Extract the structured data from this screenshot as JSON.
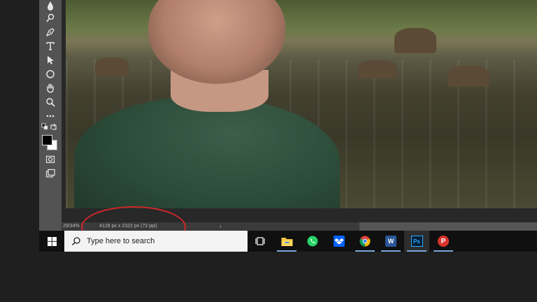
{
  "status_bar": {
    "zoom": "29/34%",
    "doc_info": "4128 px x 2322 px (72 ppi)",
    "arrow": "›"
  },
  "taskbar": {
    "search_placeholder": "Type here to search",
    "apps": [
      {
        "name": "Task View"
      },
      {
        "name": "File Explorer"
      },
      {
        "name": "WhatsApp"
      },
      {
        "name": "Dropbox"
      },
      {
        "name": "Google Chrome"
      },
      {
        "name": "Microsoft Word",
        "letter": "W"
      },
      {
        "name": "Adobe Photoshop",
        "letter": "Ps"
      },
      {
        "name": "Psiphon",
        "letter": "P"
      }
    ]
  },
  "colors": {
    "highlight": "#d2262a",
    "toolbar": "#535353",
    "taskbar": "#101010",
    "ps_blue": "#31a8ff"
  }
}
